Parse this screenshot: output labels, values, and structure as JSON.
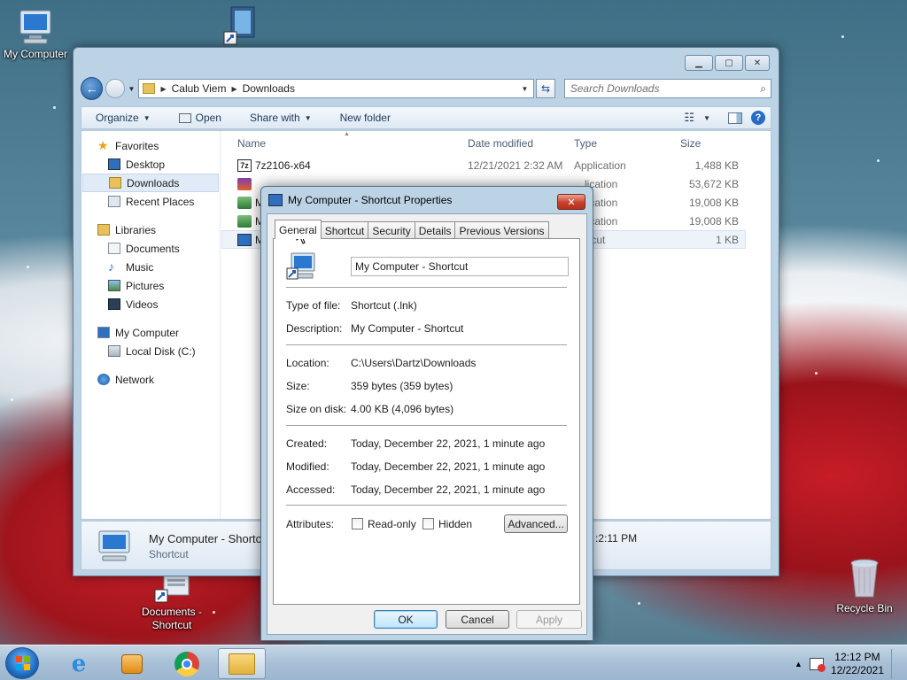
{
  "desktop": {
    "icons": [
      {
        "label": "My Computer"
      },
      {
        "label": "Documents -\nShortcut"
      },
      {
        "label": "Recycle Bin"
      }
    ]
  },
  "explorer": {
    "address": {
      "crumbs": [
        "Calub Viem",
        "Downloads"
      ]
    },
    "search_placeholder": "Search Downloads",
    "toolbar": {
      "organize": "Organize",
      "open": "Open",
      "share_with": "Share with",
      "new_folder": "New folder"
    },
    "nav": {
      "favorites": "Favorites",
      "desktop": "Desktop",
      "downloads": "Downloads",
      "recent_places": "Recent Places",
      "libraries": "Libraries",
      "documents": "Documents",
      "music": "Music",
      "pictures": "Pictures",
      "videos": "Videos",
      "my_computer": "My Computer",
      "local_disk": "Local Disk (C:)",
      "network": "Network"
    },
    "columns": {
      "name": "Name",
      "date_modified": "Date modified",
      "type": "Type",
      "size": "Size"
    },
    "files": [
      {
        "name": "7z2106-x64",
        "date": "12/21/2021 2:32 AM",
        "type": "Application",
        "size": "1,488 KB"
      },
      {
        "name": "",
        "date": "",
        "type": "lication",
        "size": "53,672 KB"
      },
      {
        "name": "M",
        "date": "",
        "type": "lication",
        "size": "19,008 KB"
      },
      {
        "name": "M",
        "date": "",
        "type": "lication",
        "size": "19,008 KB"
      },
      {
        "name": "M",
        "date": "",
        "type": "rtcut",
        "size": "1 KB"
      }
    ],
    "details": {
      "title": "My Computer - Shortc",
      "subtitle": "Shortcut",
      "right_text": ":2:11 PM"
    }
  },
  "dialog": {
    "title": "My Computer - Shortcut Properties",
    "close": "✕",
    "tabs": [
      "General",
      "Shortcut",
      "Security",
      "Details",
      "Previous Versions"
    ],
    "name_value": "My Computer - Shortcut",
    "props": {
      "type_label": "Type of file:",
      "type_value": "Shortcut (.lnk)",
      "desc_label": "Description:",
      "desc_value": "My Computer - Shortcut",
      "loc_label": "Location:",
      "loc_value": "C:\\Users\\Dartz\\Downloads",
      "size_label": "Size:",
      "size_value": "359 bytes (359 bytes)",
      "disk_label": "Size on disk:",
      "disk_value": "4.00 KB (4,096 bytes)",
      "created_label": "Created:",
      "created_value": "Today, December 22, 2021, 1 minute ago",
      "modified_label": "Modified:",
      "modified_value": "Today, December 22, 2021, 1 minute ago",
      "accessed_label": "Accessed:",
      "accessed_value": "Today, December 22, 2021, 1 minute ago",
      "attr_label": "Attributes:",
      "readonly": "Read-only",
      "hidden": "Hidden",
      "advanced": "Advanced..."
    },
    "buttons": {
      "ok": "OK",
      "cancel": "Cancel",
      "apply": "Apply"
    }
  },
  "taskbar": {
    "time": "12:12 PM",
    "date": "12/22/2021",
    "tray_up": "▲"
  }
}
